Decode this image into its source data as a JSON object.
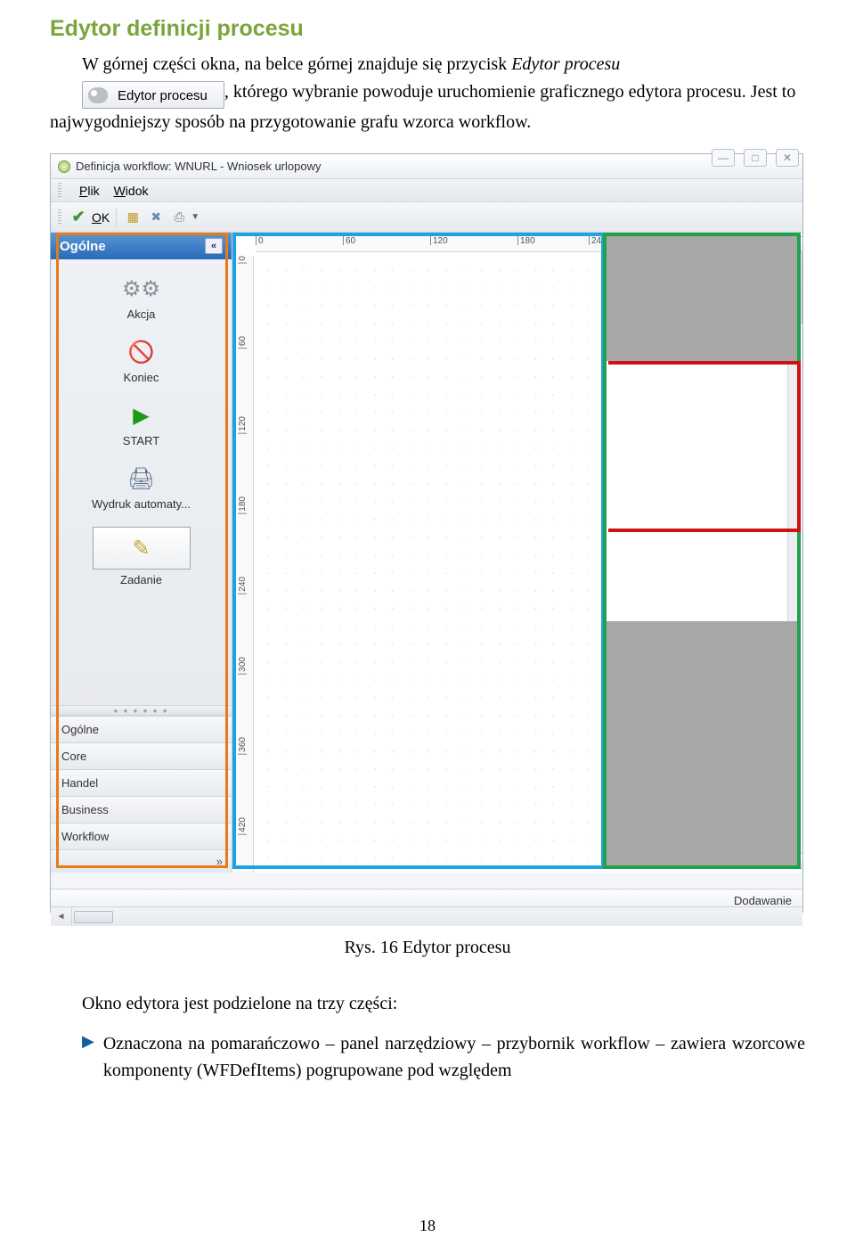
{
  "heading": "Edytor definicji procesu",
  "para1": "W górnej części okna, na belce górnej znajduje się przycisk Edytor procesu",
  "para1_italic": "Edytor procesu",
  "app_button_label": "Edytor procesu",
  "para2_a": ", którego wybranie powoduje uruchomienie graficznego edytora procesu. Jest to najwygodniejszy sposób na przygotowanie grafu wzorca workflow.",
  "window": {
    "title": "Definicja workflow: WNURL - Wniosek urlopowy",
    "win_min": "—",
    "win_max": "□",
    "win_close": "✕",
    "menu_plik": "Plik",
    "menu_widok": "Widok",
    "toolbar_ok": "OK",
    "status_text": "Dodawanie",
    "sidebar": {
      "header": "Ogólne",
      "collapse": "«",
      "items": [
        {
          "label": "Akcja"
        },
        {
          "label": "Koniec"
        },
        {
          "label": "START"
        },
        {
          "label": "Wydruk automaty..."
        },
        {
          "label": "Zadanie"
        }
      ],
      "cats": [
        "Ogólne",
        "Core",
        "Handel",
        "Business",
        "Workflow"
      ],
      "expand": "»"
    },
    "ruler_h": [
      "0",
      "60",
      "120",
      "180",
      "24"
    ],
    "ruler_v": [
      "0",
      "60",
      "120",
      "180",
      "240",
      "300",
      "360",
      "420"
    ]
  },
  "caption": "Rys. 16 Edytor procesu",
  "para3": "Okno edytora jest podzielone na trzy części:",
  "bullet": "Oznaczona na pomarańczowo – panel narzędziowy – przybornik workflow – zawiera wzorcowe komponenty (WFDefItems) pogrupowane pod względem",
  "page_num": "18"
}
